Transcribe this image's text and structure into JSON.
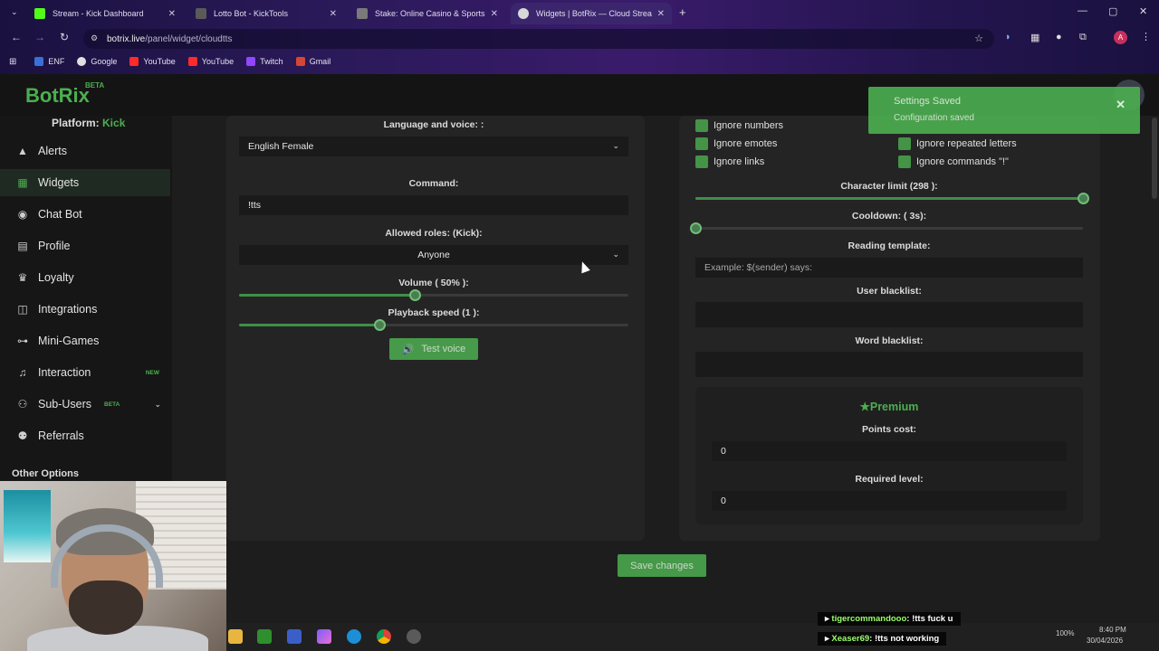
{
  "browser": {
    "tabs": [
      {
        "title": "Stream - Kick Dashboard",
        "color": "#53fc18"
      },
      {
        "title": "Lotto Bot - KickTools",
        "color": "#5a5a5a"
      },
      {
        "title": "Stake: Online Casino & Sports",
        "color": "#7a7a7a"
      },
      {
        "title": "Widgets | BotRix — Cloud Strea",
        "color": "#d8d8d8"
      }
    ],
    "url_host": "botrix.live",
    "url_path": "/panel/widget/cloudtts",
    "bookmarks": [
      {
        "label": "ENF",
        "color": "#3b6fd8"
      },
      {
        "label": "Google",
        "color": "#e0e0e0"
      },
      {
        "label": "YouTube",
        "color": "#ff2b2b"
      },
      {
        "label": "YouTube",
        "color": "#ff2b2b"
      },
      {
        "label": "Twitch",
        "color": "#9146ff"
      },
      {
        "label": "Gmail",
        "color": "#d44638"
      }
    ]
  },
  "app": {
    "logo": "BotRix",
    "logo_badge": "BETA",
    "platform_label": "Platform:",
    "platform_value": "Kick",
    "nav": [
      {
        "label": "Alerts",
        "icon": "warning-icon"
      },
      {
        "label": "Widgets",
        "icon": "grid-icon"
      },
      {
        "label": "Chat Bot",
        "icon": "robot-icon"
      },
      {
        "label": "Profile",
        "icon": "id-card-icon"
      },
      {
        "label": "Loyalty",
        "icon": "trophy-icon"
      },
      {
        "label": "Integrations",
        "icon": "puzzle-icon"
      },
      {
        "label": "Mini-Games",
        "icon": "gamepad-icon"
      },
      {
        "label": "Interaction",
        "icon": "music-icon",
        "badge": "NEW"
      },
      {
        "label": "Sub-Users",
        "icon": "users-icon",
        "badge": "BETA"
      },
      {
        "label": "Referrals",
        "icon": "people-icon"
      }
    ],
    "other_options": "Other Options",
    "accent": "#4caf50"
  },
  "left_panel": {
    "language_label": "Language and voice: :",
    "language_value": "English Female",
    "command_label": "Command:",
    "command_value": "!tts",
    "roles_label": "Allowed roles: (Kick):",
    "roles_value": "Anyone",
    "volume_label": "Volume ( 50% ):",
    "volume_value": 0.45,
    "speed_label": "Playback speed (1 ):",
    "speed_value": 0.36,
    "test_button": "Test voice"
  },
  "right_panel": {
    "checkboxes": [
      {
        "label": "Ignore numbers"
      },
      {
        "label": "Ignore emotes"
      },
      {
        "label": "Ignore links"
      },
      {
        "label": "Ignore repeated letters"
      },
      {
        "label": "Ignore commands \"!\""
      }
    ],
    "char_limit_label": "Character limit (298 ):",
    "char_limit_value": 1.0,
    "cooldown_label": "Cooldown: ( 3s):",
    "cooldown_value": 0.0,
    "template_label": "Reading template:",
    "template_placeholder": "Example: $(sender) says:",
    "user_blacklist_label": "User blacklist:",
    "word_blacklist_label": "Word blacklist:",
    "premium_title": "Premium",
    "points_cost_label": "Points cost:",
    "points_cost_value": "0",
    "required_level_label": "Required level:",
    "required_level_value": "0"
  },
  "save_button": "Save changes",
  "toast": {
    "title": "Settings Saved",
    "message": "Configuration saved"
  },
  "stream_chat": [
    {
      "user": "tigercommandooo",
      "message": ": !tts fuck u"
    },
    {
      "user": "Xeaser69",
      "message": ": !tts not working"
    }
  ],
  "tray": {
    "battery": "100%",
    "time": "8:40 PM",
    "date": "30/04/2026"
  }
}
